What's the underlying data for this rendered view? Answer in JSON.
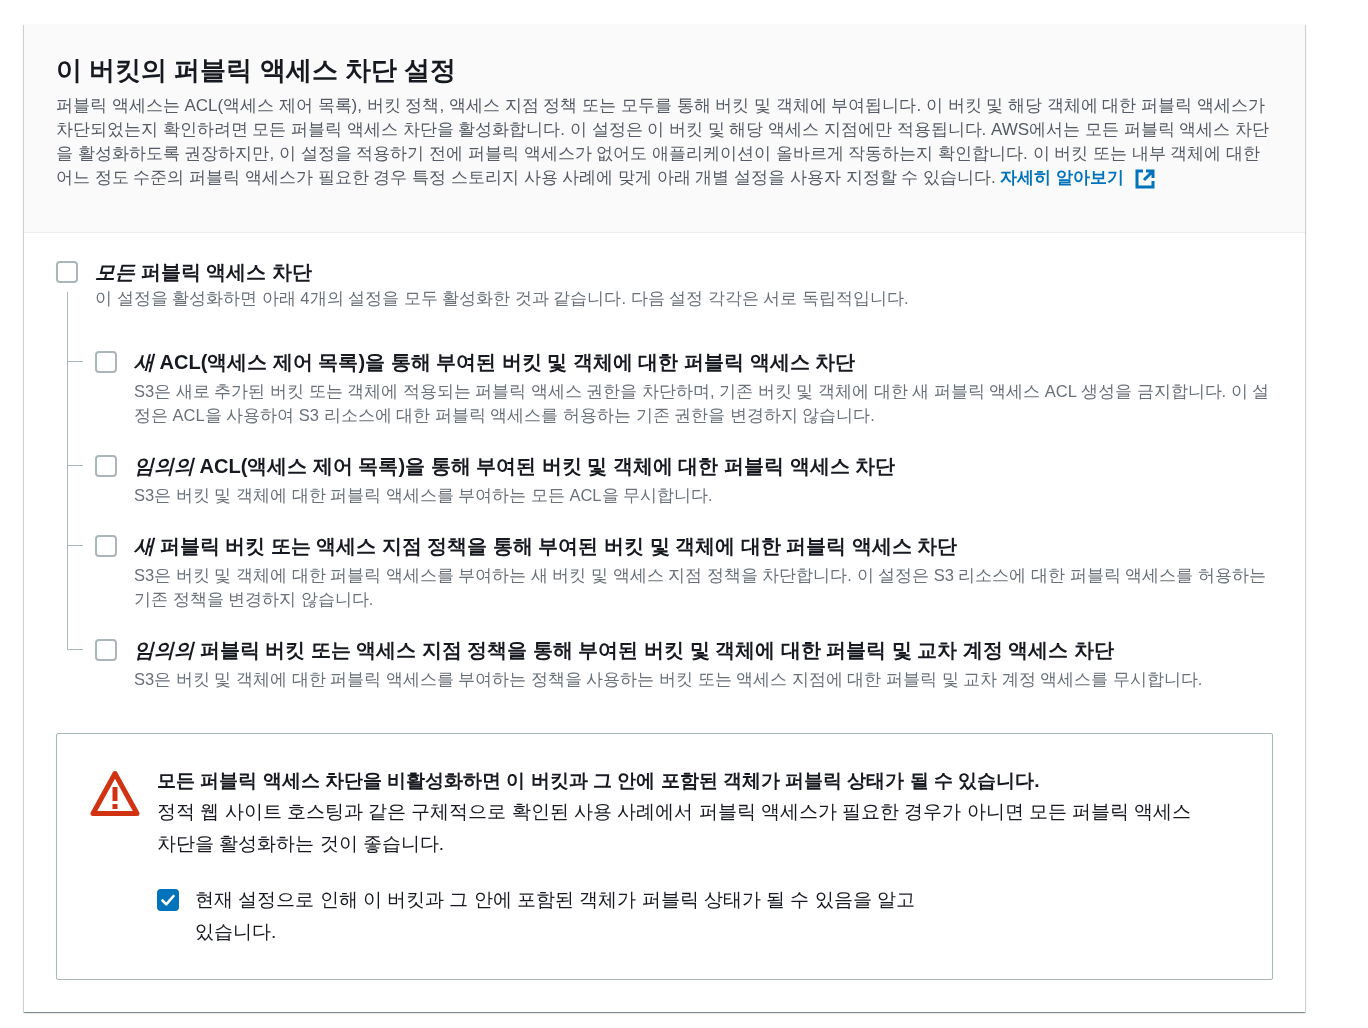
{
  "panel": {
    "title": "이 버킷의 퍼블릭 액세스 차단 설정",
    "description": "퍼블릭 액세스는 ACL(액세스 제어 목록), 버킷 정책, 액세스 지점 정책 또는 모두를 통해 버킷 및 객체에 부여됩니다. 이 버킷 및 해당 객체에 대한 퍼블릭 액세스가 차단되었는지 확인하려면 모든 퍼블릭 액세스 차단을 활성화합니다. 이 설정은 이 버킷 및 해당 액세스 지점에만 적용됩니다. AWS에서는 모든 퍼블릭 액세스 차단을 활성화하도록 권장하지만, 이 설정을 적용하기 전에 퍼블릭 액세스가 없어도 애플리케이션이 올바르게 작동하는지 확인합니다. 이 버킷 또는 내부 객체에 대한 어느 정도 수준의 퍼블릭 액세스가 필요한 경우 특정 스토리지 사용 사례에 맞게 아래 개별 설정을 사용자 지정할 수 있습니다.",
    "learn_more_link": "자세히 알아보기"
  },
  "block_all": {
    "label": "*모든* 퍼블릭 액세스 차단",
    "description": "이 설정을 활성화하면 아래 4개의 설정을 모두 활성화한 것과 같습니다. 다음 설정 각각은 서로 독립적입니다.",
    "checked": false,
    "children": [
      {
        "label": "*새* ACL(액세스 제어 목록)을 통해 부여된 버킷 및 객체에 대한 퍼블릭 액세스 차단",
        "description": "S3은 새로 추가된 버킷 또는 객체에 적용되는 퍼블릭 액세스 권한을 차단하며, 기존 버킷 및 객체에 대한 새 퍼블릭 액세스 ACL 생성을 금지합니다. 이 설정은 ACL을 사용하여 S3 리소스에 대한 퍼블릭 액세스를 허용하는 기존 권한을 변경하지 않습니다.",
        "checked": false
      },
      {
        "label": "*임의의* ACL(액세스 제어 목록)을 통해 부여된 버킷 및 객체에 대한 퍼블릭 액세스 차단",
        "description": "S3은 버킷 및 객체에 대한 퍼블릭 액세스를 부여하는 모든 ACL을 무시합니다.",
        "checked": false
      },
      {
        "label": "*새* 퍼블릭 버킷 또는 액세스 지점 정책을 통해 부여된 버킷 및 객체에 대한 퍼블릭 액세스 차단",
        "description": "S3은 버킷 및 객체에 대한 퍼블릭 액세스를 부여하는 새 버킷 및 액세스 지점 정책을 차단합니다. 이 설정은 S3 리소스에 대한 퍼블릭 액세스를 허용하는 기존 정책을 변경하지 않습니다.",
        "checked": false
      },
      {
        "label": "*임의의* 퍼블릭 버킷 또는 액세스 지점 정책을 통해 부여된 버킷 및 객체에 대한 퍼블릭 및 교차 계정 액세스 차단",
        "description": "S3은 버킷 및 객체에 대한 퍼블릭 액세스를 부여하는 정책을 사용하는 버킷 또는 액세스 지점에 대한 퍼블릭 및 교차 계정 액세스를 무시합니다.",
        "checked": false
      }
    ]
  },
  "warning": {
    "title": "모든 퍼블릭 액세스 차단을 비활성화하면 이 버킷과 그 안에 포함된 객체가 퍼블릭 상태가 될 수 있습니다.",
    "body": "정적 웹 사이트 호스팅과 같은 구체적으로 확인된 사용 사례에서 퍼블릭 액세스가 필요한 경우가 아니면 모든 퍼블릭 액세스 차단을 활성화하는 것이 좋습니다.",
    "acknowledge": {
      "label": "현재 설정으로 인해 이 버킷과 그 안에 포함된 객체가 퍼블릭 상태가 될 수 있음을 알고 있습니다.",
      "checked": true
    }
  }
}
